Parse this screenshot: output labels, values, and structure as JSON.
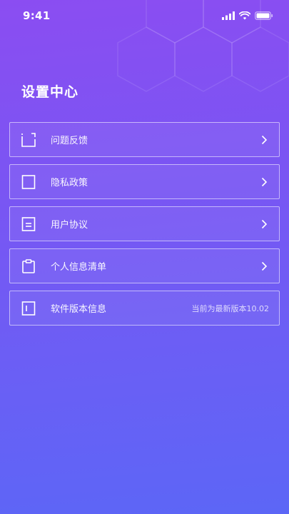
{
  "status_bar": {
    "time": "9:41",
    "icons": [
      "signal-icon",
      "wifi-icon",
      "battery-icon"
    ]
  },
  "page": {
    "title": "设置中心"
  },
  "menu": {
    "items": [
      {
        "label": "问题反馈",
        "icon": "feedback-icon",
        "value": "",
        "chevron": true
      },
      {
        "label": "隐私政策",
        "icon": "privacy-icon",
        "value": "",
        "chevron": true
      },
      {
        "label": "用户协议",
        "icon": "agreement-icon",
        "value": "",
        "chevron": true
      },
      {
        "label": "个人信息清单",
        "icon": "clipboard-icon",
        "value": "",
        "chevron": true
      },
      {
        "label": "软件版本信息",
        "icon": "version-icon",
        "value": "当前为最新版本10.02",
        "chevron": false
      }
    ]
  },
  "colors": {
    "gradient_top": "#8b4df2",
    "gradient_bottom": "#5c66f6",
    "text": "#ffffff",
    "border": "rgba(255,255,255,0.55)"
  }
}
